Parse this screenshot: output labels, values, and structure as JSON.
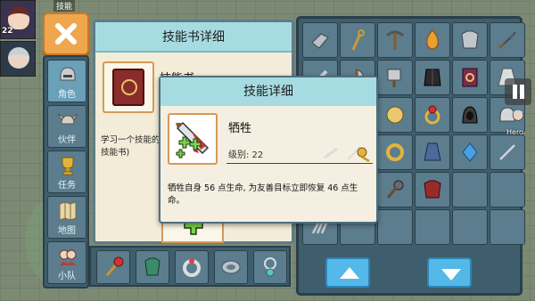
{
  "hud": {
    "top_label": "技能",
    "badge": "22"
  },
  "nav": {
    "items": [
      {
        "label": "角色",
        "icon": "helmet-icon"
      },
      {
        "label": "伙伴",
        "icon": "horned-helmet-icon"
      },
      {
        "label": "任务",
        "icon": "trophy-icon"
      },
      {
        "label": "地图",
        "icon": "map-icon"
      },
      {
        "label": "小队",
        "icon": "party-icon"
      }
    ]
  },
  "book_panel": {
    "title": "技能书详细",
    "name": "技能书",
    "description": "学习一个技能的书 技能书)"
  },
  "detail": {
    "title": "技能详细",
    "skill_name": "牺牲",
    "level_text": "级别: 22",
    "description": "牺牲自身 56 点生命, 为友善目标立即恢复 46 点生命。"
  },
  "right_hud": {
    "hero_label": "Hero"
  },
  "colors": {
    "header_bg": "#a7dbe2",
    "panel_bg": "#f3ecd9",
    "inventory_bg": "#3f5e6d",
    "close_button": "#f0a64c",
    "arrow_button": "#54b8e8",
    "slot_border": "#d49a55"
  }
}
